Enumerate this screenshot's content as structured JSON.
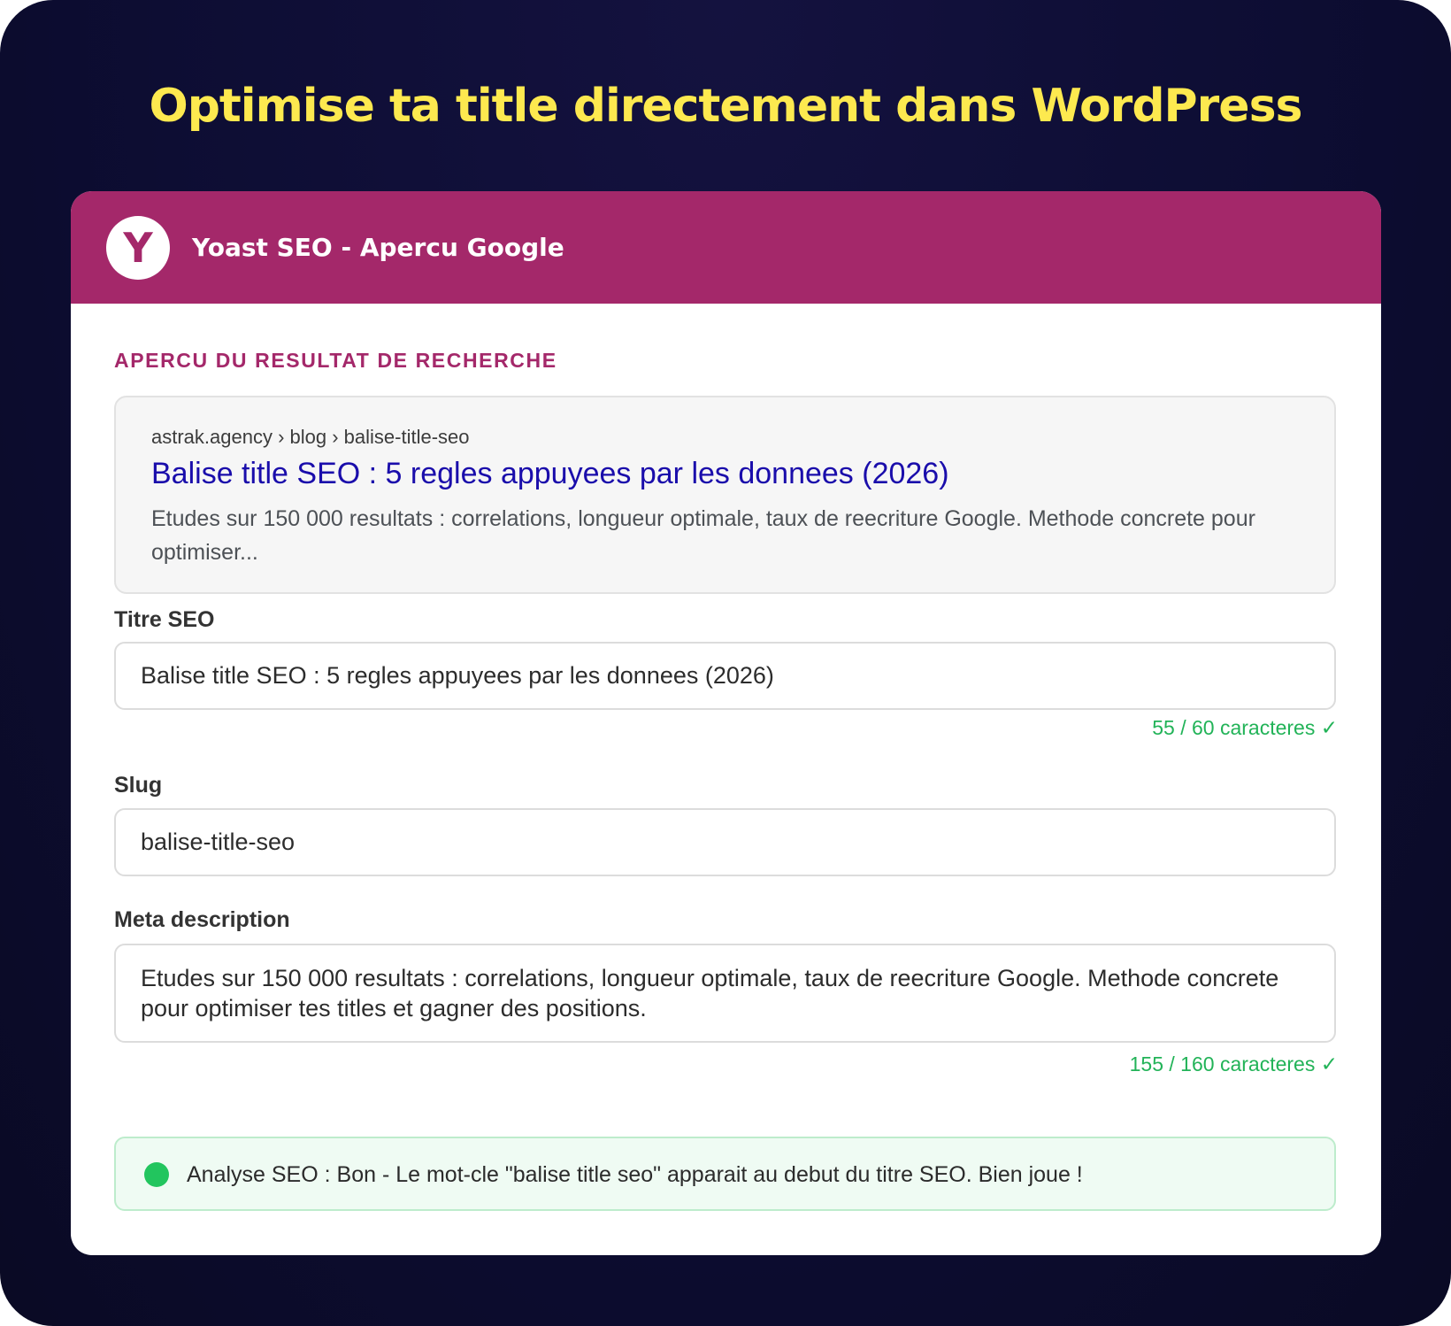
{
  "headline": "Optimise ta title directement dans WordPress",
  "card": {
    "logo_letter": "Y",
    "header_title": "Yoast SEO - Apercu Google",
    "section_label": "APERCU DU RESULTAT DE RECHERCHE",
    "serp": {
      "breadcrumb": "astrak.agency › blog › balise-title-seo",
      "title": "Balise title SEO : 5 regles appuyees par les donnees (2026)",
      "description": "Etudes sur 150 000 resultats : correlations, longueur optimale, taux de reecriture Google. Methode concrete pour optimiser..."
    },
    "fields": {
      "seo_title": {
        "label": "Titre SEO",
        "value": "Balise title SEO : 5 regles appuyees par les donnees (2026)",
        "counter": "55 / 60 caracteres ✓"
      },
      "slug": {
        "label": "Slug",
        "value": "balise-title-seo"
      },
      "meta_description": {
        "label": "Meta description",
        "value": "Etudes sur 150 000 resultats : correlations, longueur optimale, taux de reecriture Google. Methode concrete pour optimiser tes titles et gagner des positions.",
        "counter": "155 / 160 caracteres ✓"
      }
    },
    "analysis": {
      "text": "Analyse SEO : Bon - Le mot-cle \"balise title seo\" apparait au debut du titre SEO. Bien joue !",
      "status_color": "#22c55e"
    }
  },
  "colors": {
    "brand": "#a4286a",
    "headline": "#fde94f",
    "serp_link": "#1a0dab",
    "ok": "#22b358"
  }
}
